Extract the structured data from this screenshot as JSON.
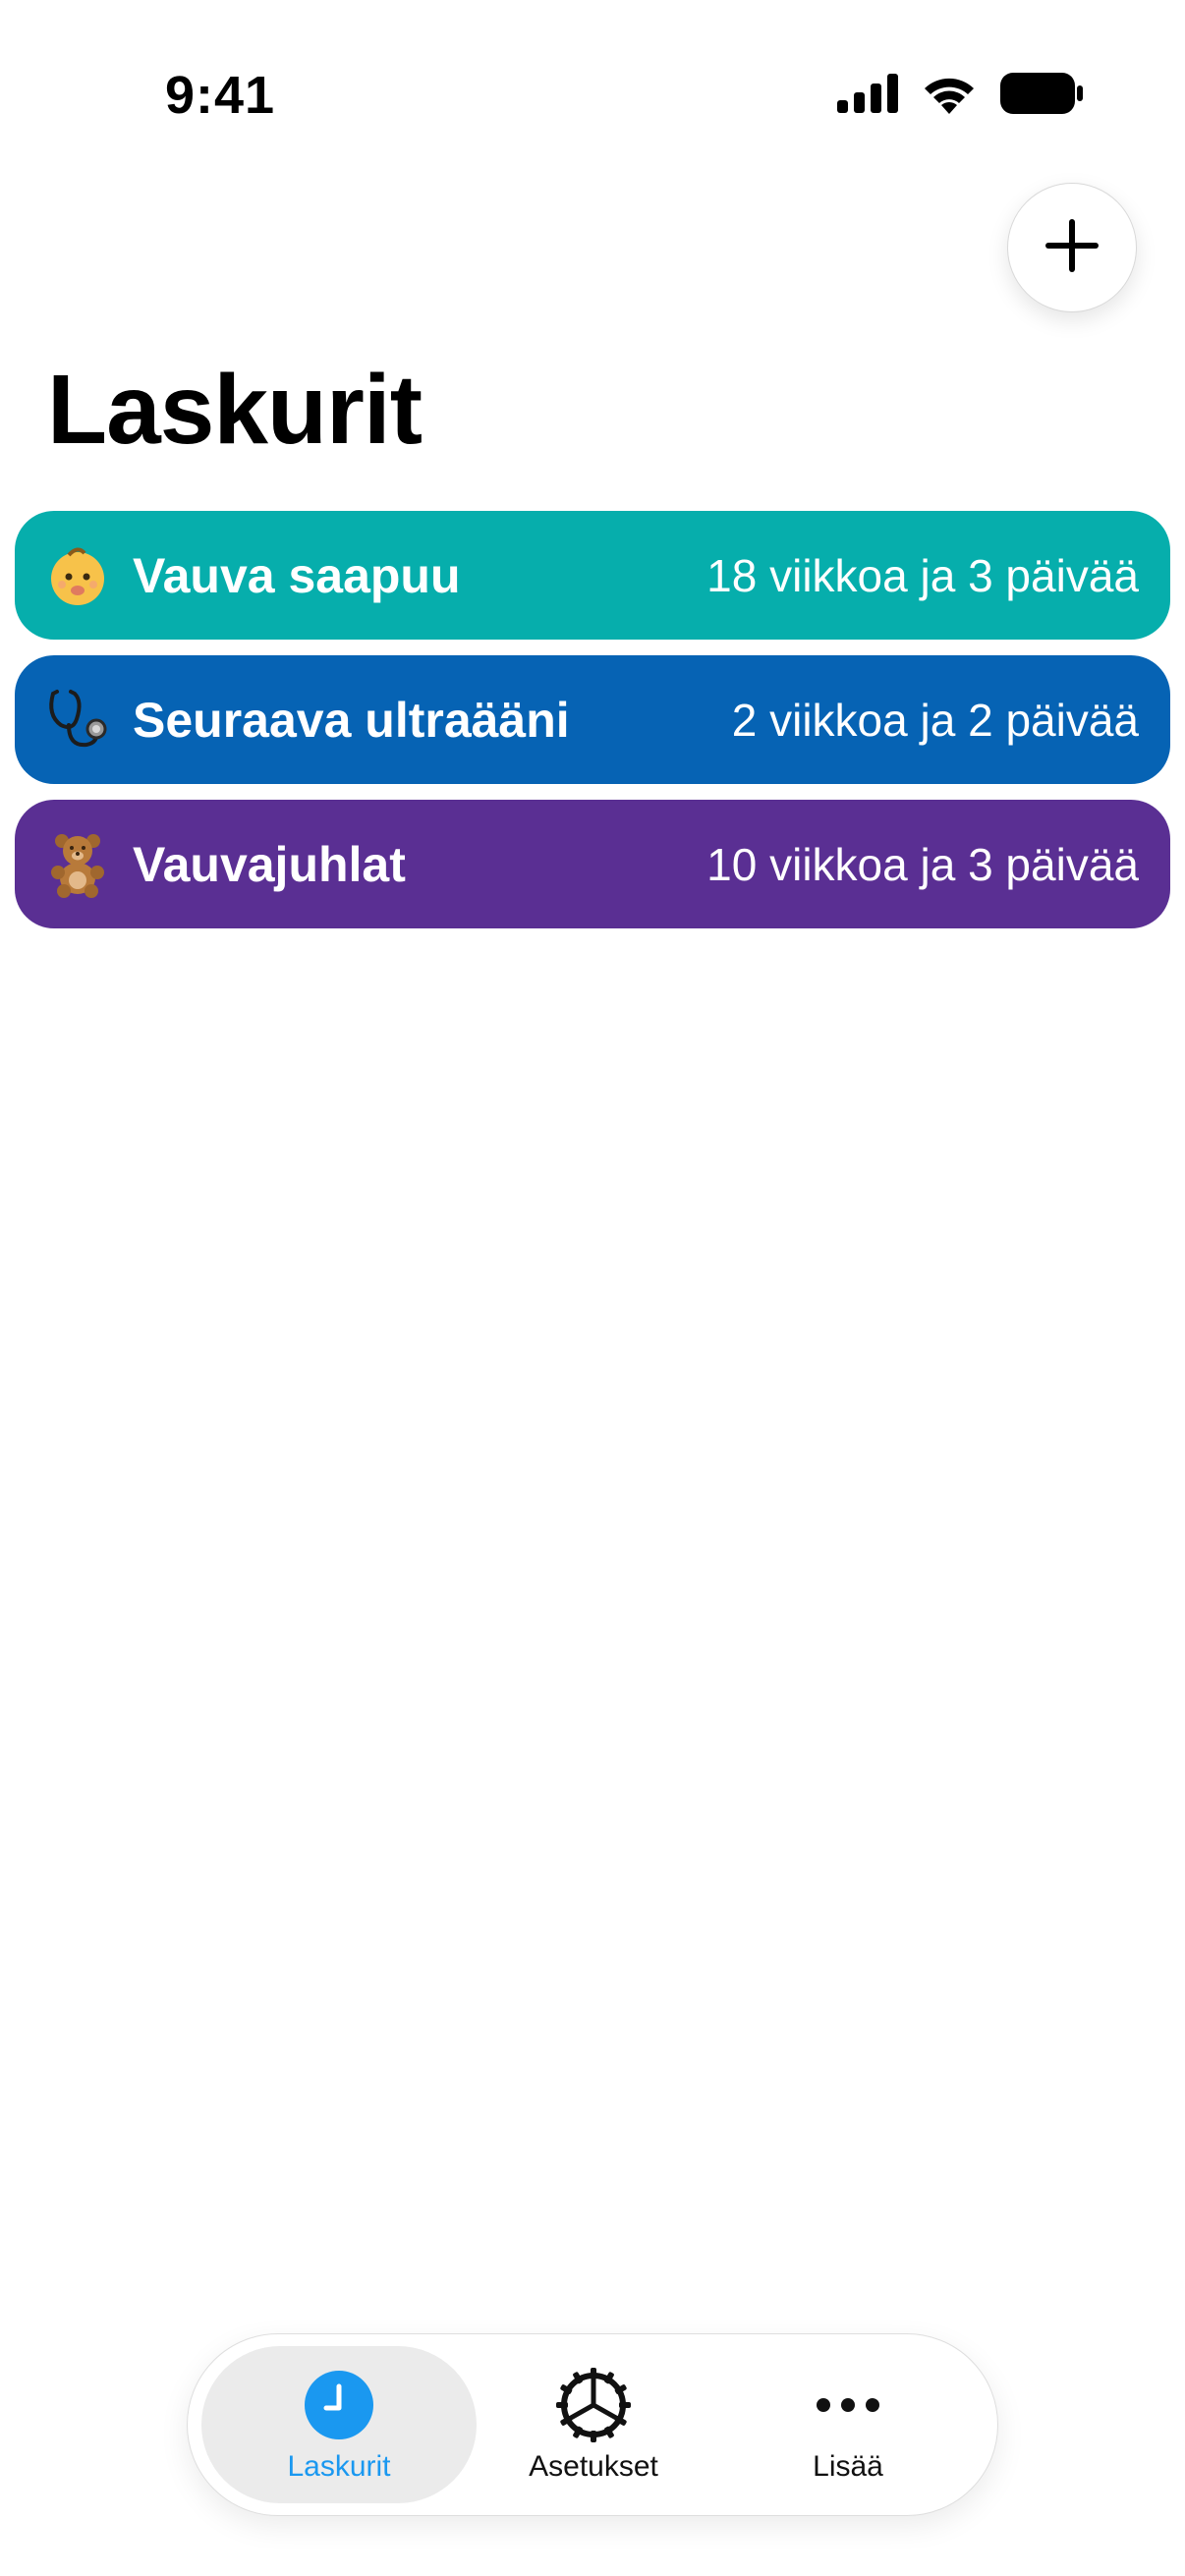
{
  "status_bar": {
    "time": "9:41"
  },
  "header": {
    "add_icon": "plus-icon",
    "title": "Laskurit"
  },
  "counters": [
    {
      "emoji": "baby-emoji",
      "title": "Vauva saapuu",
      "value": "18 viikkoa ja 3 päivää",
      "color": "#06AEAC"
    },
    {
      "emoji": "stethoscope-emoji",
      "title": "Seuraava ultraääni",
      "value": "2 viikkoa ja 2 päivää",
      "color": "#0663B4"
    },
    {
      "emoji": "teddy-bear-emoji",
      "title": "Vauvajuhlat",
      "value": "10 viikkoa ja 3 päivää",
      "color": "#5A2F93"
    }
  ],
  "tab_bar": {
    "items": [
      {
        "label": "Laskurit",
        "icon": "clock-icon",
        "active": true
      },
      {
        "label": "Asetukset",
        "icon": "gear-icon",
        "active": false
      },
      {
        "label": "Lisää",
        "icon": "more-icon",
        "active": false
      }
    ],
    "accent_color": "#1A98F0"
  }
}
